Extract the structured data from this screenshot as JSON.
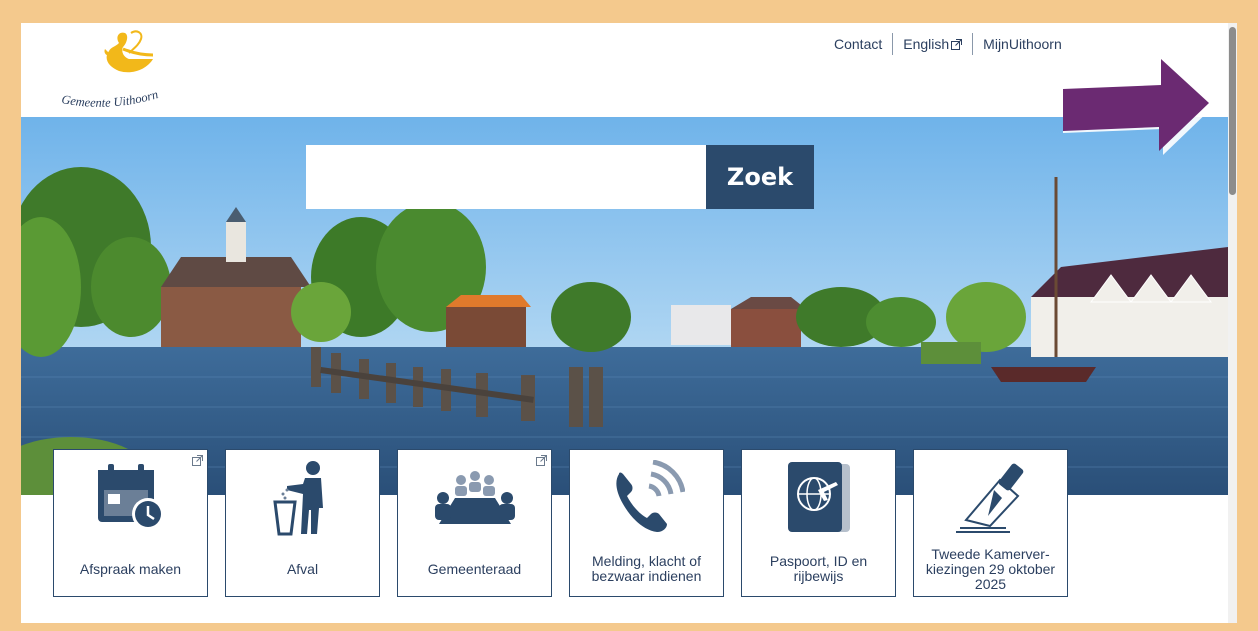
{
  "logo": {
    "text": "Gemeente Uithoorn"
  },
  "top_nav": {
    "contact": "Contact",
    "english": "English",
    "mijn": "MijnUithoorn"
  },
  "search": {
    "placeholder": "",
    "button_label": "Zoek"
  },
  "tiles": [
    {
      "label": "Afspraak maken",
      "icon": "calendar-clock-icon",
      "external": true
    },
    {
      "label": "Afval",
      "icon": "trash-person-icon",
      "external": false
    },
    {
      "label": "Gemeenteraad",
      "icon": "council-meeting-icon",
      "external": true
    },
    {
      "label": "Melding, klacht of bezwaar indienen",
      "icon": "phone-icon",
      "external": false
    },
    {
      "label": "Paspoort, ID en rijbewijs",
      "icon": "passport-icon",
      "external": false
    },
    {
      "label": "Tweede Kamerver-kiezingen 29 oktober 2025",
      "icon": "ballot-vote-icon",
      "external": false
    }
  ],
  "colors": {
    "brand": "#2b4a6c",
    "logo_yellow": "#f2b81a",
    "arrow": "#6b2a72",
    "border": "#f4c98d"
  }
}
